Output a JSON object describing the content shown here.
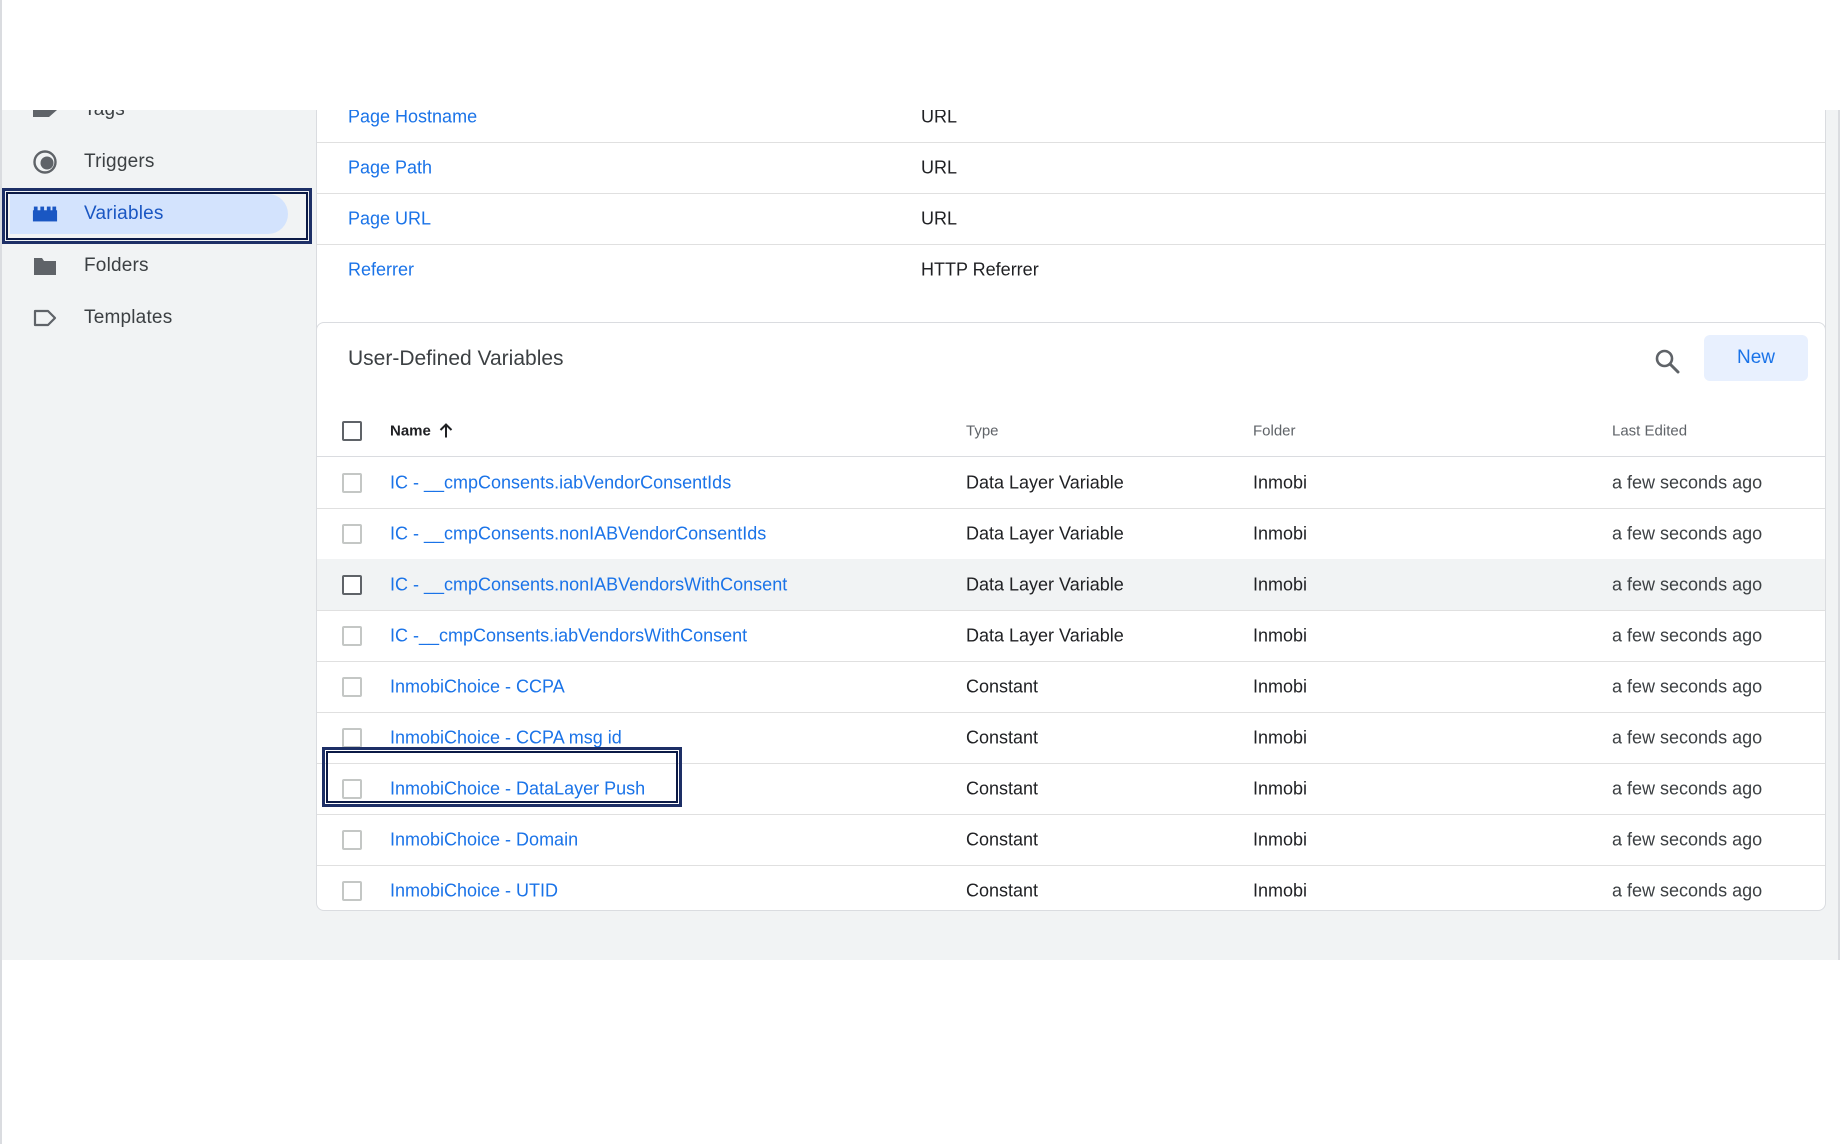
{
  "sidebar": {
    "items": [
      {
        "label": "Tags",
        "icon": "tag-icon"
      },
      {
        "label": "Triggers",
        "icon": "trigger-icon"
      },
      {
        "label": "Variables",
        "icon": "variables-icon",
        "active": true
      },
      {
        "label": "Folders",
        "icon": "folder-icon"
      },
      {
        "label": "Templates",
        "icon": "template-icon"
      }
    ]
  },
  "builtin": {
    "rows": [
      {
        "name": "Page Hostname",
        "type": "URL"
      },
      {
        "name": "Page Path",
        "type": "URL"
      },
      {
        "name": "Page URL",
        "type": "URL"
      },
      {
        "name": "Referrer",
        "type": "HTTP Referrer"
      }
    ]
  },
  "user_defined": {
    "title": "User-Defined Variables",
    "new_label": "New",
    "columns": {
      "name": "Name",
      "type": "Type",
      "folder": "Folder",
      "last_edited": "Last Edited"
    },
    "rows": [
      {
        "name": "IC - __cmpConsents.iabVendorConsentIds",
        "type": "Data Layer Variable",
        "folder": "Inmobi",
        "edited": "a few seconds ago"
      },
      {
        "name": "IC - __cmpConsents.nonIABVendorConsentIds",
        "type": "Data Layer Variable",
        "folder": "Inmobi",
        "edited": "a few seconds ago"
      },
      {
        "name": "IC - __cmpConsents.nonIABVendorsWithConsent",
        "type": "Data Layer Variable",
        "folder": "Inmobi",
        "edited": "a few seconds ago"
      },
      {
        "name": "IC -__cmpConsents.iabVendorsWithConsent",
        "type": "Data Layer Variable",
        "folder": "Inmobi",
        "edited": "a few seconds ago"
      },
      {
        "name": "InmobiChoice - CCPA",
        "type": "Constant",
        "folder": "Inmobi",
        "edited": "a few seconds ago"
      },
      {
        "name": "InmobiChoice - CCPA msg id",
        "type": "Constant",
        "folder": "Inmobi",
        "edited": "a few seconds ago"
      },
      {
        "name": "InmobiChoice - DataLayer Push",
        "type": "Constant",
        "folder": "Inmobi",
        "edited": "a few seconds ago"
      },
      {
        "name": "InmobiChoice - Domain",
        "type": "Constant",
        "folder": "Inmobi",
        "edited": "a few seconds ago"
      },
      {
        "name": "InmobiChoice - UTID",
        "type": "Constant",
        "folder": "Inmobi",
        "edited": "a few seconds ago"
      }
    ]
  },
  "colors": {
    "link": "#1a73e8",
    "active_pill": "#d3e3fd",
    "highlight_border": "#1d2f66",
    "app_background": "#f1f3f4"
  }
}
